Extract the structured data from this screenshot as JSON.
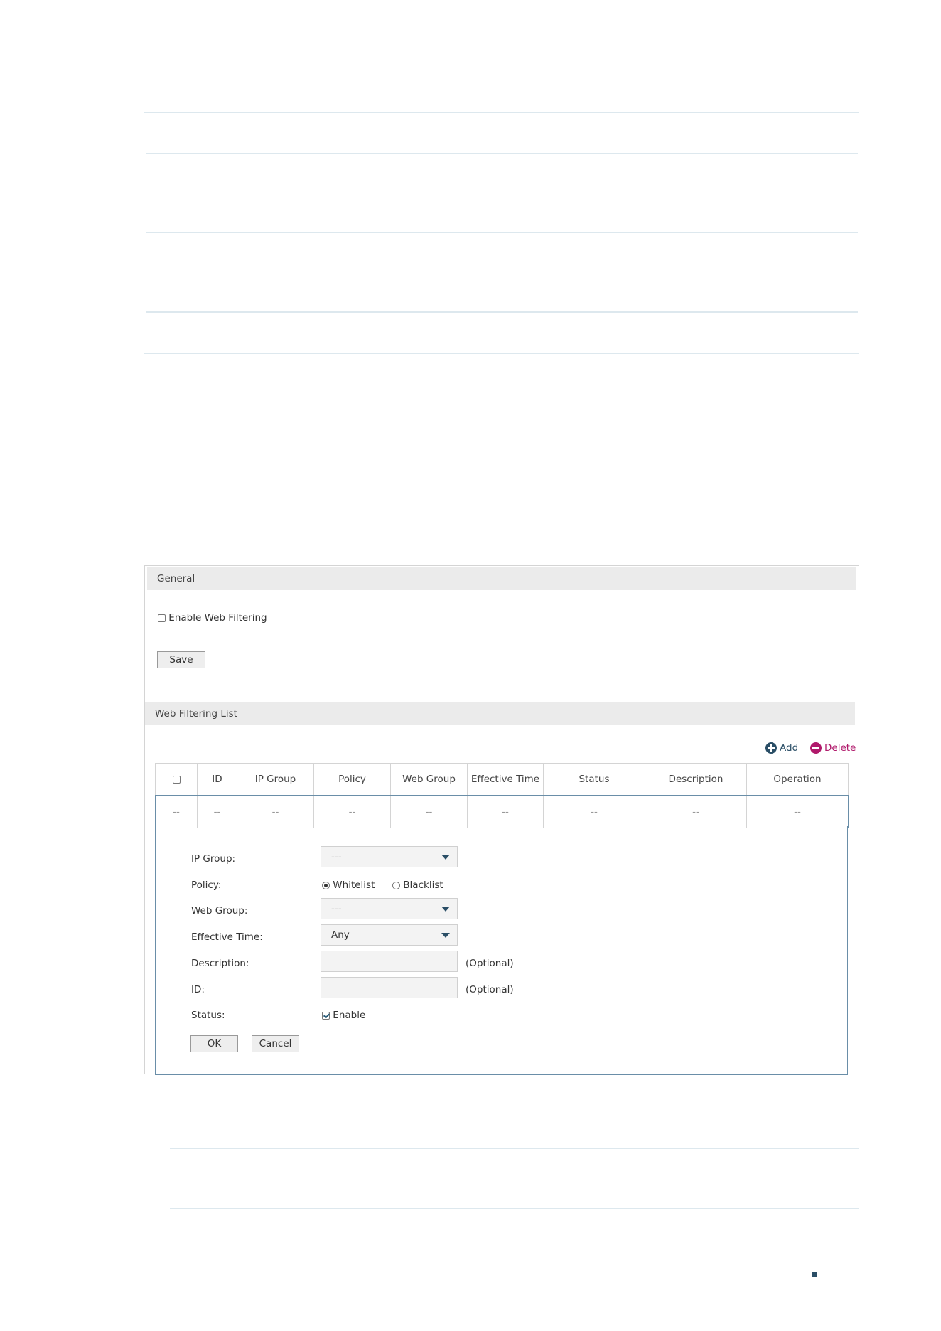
{
  "general": {
    "title": "General",
    "enable_label": "Enable Web Filtering",
    "enable_checked": false,
    "save_label": "Save"
  },
  "list": {
    "title": "Web Filtering List",
    "add_label": "Add",
    "delete_label": "Delete",
    "add_icon": "plus-circle-icon",
    "delete_icon": "minus-circle-icon",
    "add_color": "#2a4e66",
    "delete_color": "#b0196b",
    "columns": [
      "ID",
      "IP Group",
      "Policy",
      "Web Group",
      "Effective Time",
      "Status",
      "Description",
      "Operation"
    ],
    "row": [
      "--",
      "--",
      "--",
      "--",
      "--",
      "--",
      "--",
      "--",
      "--"
    ]
  },
  "editor": {
    "ip_group_label": "IP Group:",
    "ip_group_value": "---",
    "policy_label": "Policy:",
    "policy_options": [
      "Whitelist",
      "Blacklist"
    ],
    "policy_selected": "Whitelist",
    "web_group_label": "Web Group:",
    "web_group_value": "---",
    "effective_time_label": "Effective Time:",
    "effective_time_value": "Any",
    "description_label": "Description:",
    "description_value": "",
    "description_hint": "(Optional)",
    "id_label": "ID:",
    "id_value": "",
    "id_hint": "(Optional)",
    "status_label": "Status:",
    "status_enable_label": "Enable",
    "status_checked": true,
    "ok_label": "OK",
    "cancel_label": "Cancel"
  }
}
